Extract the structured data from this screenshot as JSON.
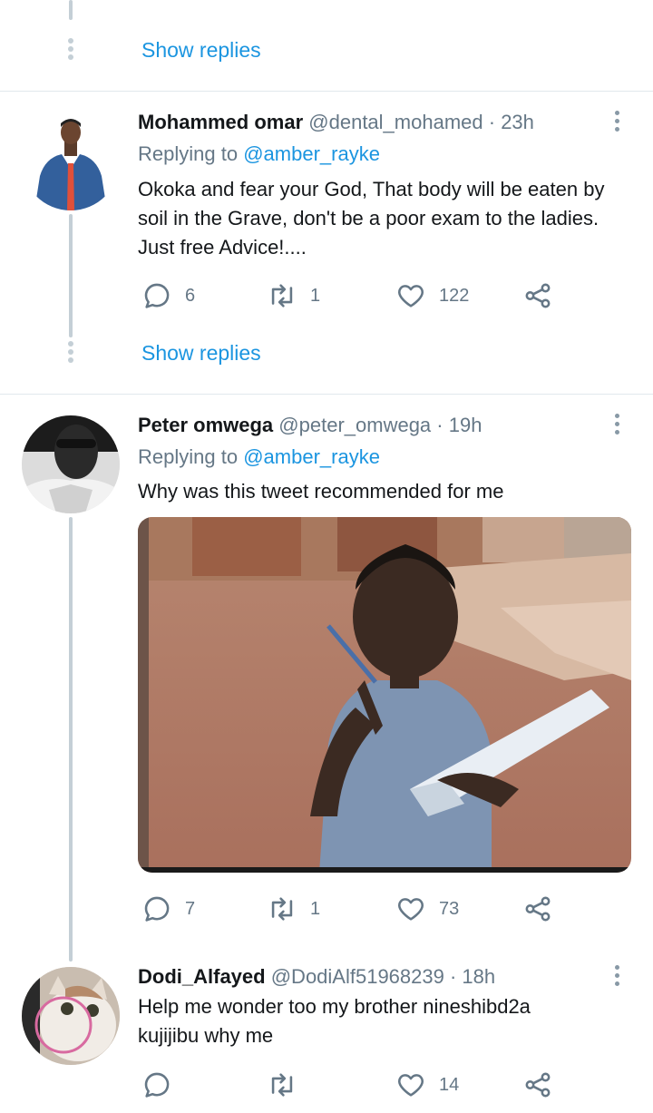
{
  "top": {
    "show_replies": "Show replies"
  },
  "tweets": [
    {
      "name": "Mohammed omar",
      "handle": "@dental_mohamed",
      "time": "· 23h",
      "replying_prefix": "Replying to",
      "replying_to": "@amber_rayke",
      "text": "Okoka and fear your God, That body will be eaten by soil in the Grave, don't be a poor exam to the ladies. Just free Advice!....",
      "replies": "6",
      "retweets": "1",
      "likes": "122",
      "show_replies": "Show replies"
    },
    {
      "name": "Peter omwega",
      "handle": "@peter_omwega",
      "time": "· 19h",
      "replying_prefix": "Replying to",
      "replying_to": "@amber_rayke",
      "text": "Why was this tweet recommended for me",
      "replies": "7",
      "retweets": "1",
      "likes": "73"
    },
    {
      "name": "Dodi_Alfayed",
      "handle": "@DodiAlf51968239",
      "time": "· 18h",
      "text": "Help me wonder too my brother nineshibd2a kujijibu why me",
      "replies": "",
      "retweets": "",
      "likes": "14"
    }
  ],
  "colors": {
    "accent": "#1b95e0",
    "muted": "#657786",
    "thread_line": "#c4cfd6",
    "divider": "#e1e8ed"
  }
}
